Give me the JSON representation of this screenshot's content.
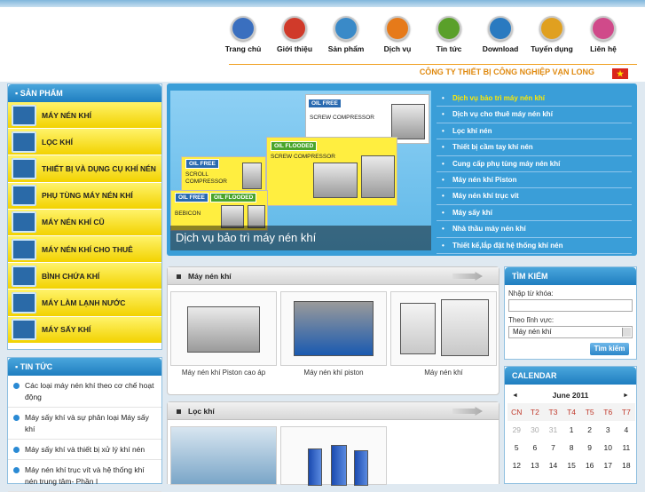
{
  "nav": [
    {
      "label": "Trang chủ",
      "icon": "home-icon",
      "color": "#3a6fbf"
    },
    {
      "label": "Giới thiệu",
      "icon": "info-icon",
      "color": "#d03a2a"
    },
    {
      "label": "Sản phẩm",
      "icon": "product-icon",
      "color": "#3a8ac8"
    },
    {
      "label": "Dịch vụ",
      "icon": "rss-icon",
      "color": "#e67a1a"
    },
    {
      "label": "Tin tức",
      "icon": "news-icon",
      "color": "#5aa02a"
    },
    {
      "label": "Download",
      "icon": "download-icon",
      "color": "#2a7ac0"
    },
    {
      "label": "Tuyển dụng",
      "icon": "recruit-icon",
      "color": "#e0a020"
    },
    {
      "label": "Liên hệ",
      "icon": "contact-icon",
      "color": "#d04a8a"
    }
  ],
  "company_name": "CÔNG TY THIẾT BỊ CÔNG NGHIỆP VẠN LONG",
  "san_pham": {
    "title": "SẢN PHẨM",
    "items": [
      "MÁY NÉN KHÍ",
      "LỌC KHÍ",
      "THIẾT BỊ VÀ DỤNG CỤ KHÍ NÉN",
      "PHỤ TÙNG MÁY NÉN KHÍ",
      "MÁY NÉN KHÍ CŨ",
      "MÁY NÉN KHÍ CHO THUÊ",
      "BÌNH CHỨA KHÍ",
      "MÁY LÀM LẠNH NƯỚC",
      "MÁY SẤY KHÍ"
    ]
  },
  "tin_tuc": {
    "title": "TIN TỨC",
    "items": [
      "Các loại máy nén khí theo cơ chế hoạt động",
      "Máy sấy khí và sự phân loại Máy sấy khí",
      "Máy sấy khí và thiết bị xử lý khí nén",
      "Máy nén khí trục vít và hệ thống khí nén trung tâm- Phần I"
    ]
  },
  "banner": {
    "caption": "Dịch vụ bảo trì máy nén khí",
    "cards": [
      {
        "badges": [
          "OIL FREE"
        ],
        "text": "SCREW COMPRESSOR"
      },
      {
        "badges": [
          "OIL FLOODED"
        ],
        "text": "SCREW COMPRESSOR"
      },
      {
        "badges": [
          "OIL FREE"
        ],
        "text": "SCROLL COMPRESSOR"
      },
      {
        "badges": [
          "OIL FREE",
          "OIL FLOODED"
        ],
        "text": "BEBICON"
      }
    ]
  },
  "services": [
    "Dịch vụ bảo trì máy nén khí",
    "Dịch vụ cho thuê máy nén khí",
    "Lọc khí nén",
    "Thiết bị cầm tay khí nén",
    "Cung cấp phụ tùng máy nén khí",
    "Máy nén khí Piston",
    "Máy nén khí trục vít",
    "Máy sấy khí",
    "Nhà thầu máy nén khí",
    "Thiết kế,lắp đặt hệ thống khí nén"
  ],
  "panel_may_nen_khi": {
    "title": "Máy nén khí",
    "products": [
      "Máy nén khí Piston cao áp",
      "Máy nén khí piston",
      "Máy nén khí"
    ]
  },
  "panel_loc_khi": {
    "title": "Lọc khí"
  },
  "search": {
    "title": "TÌM KIẾM",
    "keyword_label": "Nhập từ khóa:",
    "field_label": "Theo lĩnh vực:",
    "field_value": "Máy nén khí",
    "button": "Tìm kiếm"
  },
  "calendar": {
    "title": "CALENDAR",
    "month": "June 2011",
    "prev": "◄",
    "next": "►",
    "dow": [
      "CN",
      "T2",
      "T3",
      "T4",
      "T5",
      "T6",
      "T7"
    ],
    "weeks": [
      [
        "29",
        "30",
        "31",
        "1",
        "2",
        "3",
        "4"
      ],
      [
        "5",
        "6",
        "7",
        "8",
        "9",
        "10",
        "11"
      ],
      [
        "12",
        "13",
        "14",
        "15",
        "16",
        "17",
        "18"
      ]
    ]
  }
}
